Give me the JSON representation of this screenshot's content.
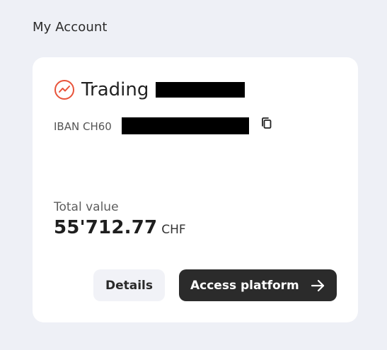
{
  "section": {
    "title": "My Account"
  },
  "account": {
    "name": "Trading",
    "iban_prefix": "IBAN CH60",
    "total_label": "Total value",
    "total_amount": "55'712.77",
    "currency": "CHF"
  },
  "actions": {
    "details_label": "Details",
    "access_label": "Access platform"
  },
  "colors": {
    "accent": "#e8533a",
    "primary_button": "#2b2b2b",
    "secondary_button": "#f1f2f7",
    "background": "#eef0f6"
  }
}
